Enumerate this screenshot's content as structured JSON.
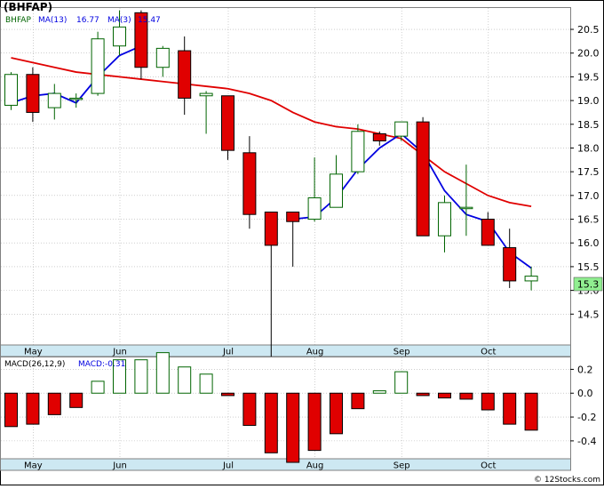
{
  "title": "(BHFAP)",
  "watermark": "© 12Stocks.com",
  "colors": {
    "up_fill": "#ffffff",
    "up_border": "#006400",
    "down_fill": "#e00000",
    "down_border": "#000000",
    "ma13": "#e00000",
    "ma3": "#0000e0",
    "macd_pos": "#006400",
    "macd_neg": "#e00000",
    "axis_band": "#cde8f2",
    "last_price_bg": "#90ee90"
  },
  "chart_data": [
    {
      "type": "candlestick",
      "title": "(BHFAP)",
      "legend": [
        {
          "label": "BHFAP",
          "color": "#006400"
        },
        {
          "label": "MA(13)",
          "value": "16.77",
          "color": "#0000e0"
        },
        {
          "label": "MA(3)",
          "value": "15.47",
          "color": "#0000e0"
        }
      ],
      "y_ticks": [
        "14.5",
        "15.0",
        "15.5",
        "16.0",
        "16.5",
        "17.0",
        "17.5",
        "18.0",
        "18.5",
        "19.0",
        "19.5",
        "20.0",
        "20.5"
      ],
      "ylim": [
        13.85,
        20.95
      ],
      "x_ticks": [
        {
          "label": "May",
          "index": 1
        },
        {
          "label": "Jun",
          "index": 5
        },
        {
          "label": "Jul",
          "index": 10
        },
        {
          "label": "Aug",
          "index": 14
        },
        {
          "label": "Sep",
          "index": 18
        },
        {
          "label": "Oct",
          "index": 22
        }
      ],
      "last_price": "15.3",
      "candles": [
        {
          "o": 18.9,
          "h": 19.6,
          "l": 18.8,
          "c": 19.55
        },
        {
          "o": 19.55,
          "h": 19.7,
          "l": 18.55,
          "c": 18.75
        },
        {
          "o": 18.85,
          "h": 19.35,
          "l": 18.6,
          "c": 19.15
        },
        {
          "o": 19.05,
          "h": 19.15,
          "l": 18.85,
          "c": 19.05
        },
        {
          "o": 19.15,
          "h": 20.45,
          "l": 19.1,
          "c": 20.3
        },
        {
          "o": 20.15,
          "h": 20.9,
          "l": 19.95,
          "c": 20.55
        },
        {
          "o": 20.85,
          "h": 20.9,
          "l": 19.45,
          "c": 19.7
        },
        {
          "o": 19.7,
          "h": 20.15,
          "l": 19.5,
          "c": 20.1
        },
        {
          "o": 20.05,
          "h": 20.35,
          "l": 18.7,
          "c": 19.05
        },
        {
          "o": 19.1,
          "h": 19.2,
          "l": 18.3,
          "c": 19.15
        },
        {
          "o": 19.1,
          "h": 19.1,
          "l": 17.75,
          "c": 17.95
        },
        {
          "o": 17.9,
          "h": 18.25,
          "l": 16.3,
          "c": 16.6
        },
        {
          "o": 16.65,
          "h": 16.65,
          "l": 13.6,
          "c": 15.95
        },
        {
          "o": 16.65,
          "h": 16.65,
          "l": 15.5,
          "c": 16.45
        },
        {
          "o": 16.5,
          "h": 17.8,
          "l": 16.45,
          "c": 16.95
        },
        {
          "o": 16.75,
          "h": 17.85,
          "l": 16.75,
          "c": 17.45
        },
        {
          "o": 17.5,
          "h": 18.5,
          "l": 17.45,
          "c": 18.35
        },
        {
          "o": 18.3,
          "h": 18.35,
          "l": 18.05,
          "c": 18.15
        },
        {
          "o": 18.25,
          "h": 18.55,
          "l": 18.15,
          "c": 18.55
        },
        {
          "o": 18.55,
          "h": 18.65,
          "l": 16.2,
          "c": 16.15
        },
        {
          "o": 16.15,
          "h": 17.0,
          "l": 15.8,
          "c": 16.85
        },
        {
          "o": 16.75,
          "h": 17.65,
          "l": 16.15,
          "c": 16.75
        },
        {
          "o": 16.5,
          "h": 16.65,
          "l": 15.95,
          "c": 15.95
        },
        {
          "o": 15.9,
          "h": 16.3,
          "l": 15.05,
          "c": 15.2
        },
        {
          "o": 15.2,
          "h": 15.5,
          "l": 15.0,
          "c": 15.3
        }
      ],
      "ma_slow": [
        19.9,
        19.8,
        19.7,
        19.6,
        19.55,
        19.5,
        19.45,
        19.4,
        19.35,
        19.3,
        19.25,
        19.15,
        19.0,
        18.75,
        18.55,
        18.45,
        18.4,
        18.3,
        18.2,
        17.85,
        17.5,
        17.25,
        17.0,
        16.85,
        16.77
      ],
      "ma_fast": [
        {
          "i": 0,
          "v": 18.95
        },
        {
          "i": 1,
          "v": 19.1
        },
        {
          "i": 2,
          "v": 19.15
        },
        {
          "i": 3,
          "v": 18.95
        },
        {
          "i": 4,
          "v": 19.5
        },
        {
          "i": 5,
          "v": 19.95
        },
        {
          "i": 6,
          "v": 20.15
        }
      ],
      "ma_fast_2": [
        {
          "i": 13,
          "v": 16.5
        },
        {
          "i": 14,
          "v": 16.55
        },
        {
          "i": 15,
          "v": 16.95
        },
        {
          "i": 16,
          "v": 17.55
        },
        {
          "i": 17,
          "v": 18.0
        },
        {
          "i": 18,
          "v": 18.3
        },
        {
          "i": 19,
          "v": 17.9
        },
        {
          "i": 20,
          "v": 17.1
        },
        {
          "i": 21,
          "v": 16.6
        },
        {
          "i": 22,
          "v": 16.45
        },
        {
          "i": 23,
          "v": 15.8
        },
        {
          "i": 24,
          "v": 15.47
        }
      ]
    },
    {
      "type": "bar",
      "title": "MACD(26,12,9)",
      "legend_value_label": "MACD:-0.31",
      "y_ticks": [
        "0.2",
        "0.0",
        "-0.2",
        "-0.4"
      ],
      "ylim": [
        -0.55,
        0.3
      ],
      "values": [
        -0.28,
        -0.26,
        -0.18,
        -0.12,
        0.1,
        0.28,
        0.28,
        0.34,
        0.22,
        0.16,
        -0.02,
        -0.27,
        -0.5,
        -0.58,
        -0.48,
        -0.34,
        -0.13,
        0.02,
        0.18,
        -0.02,
        -0.04,
        -0.05,
        -0.14,
        -0.26,
        -0.31
      ]
    }
  ]
}
